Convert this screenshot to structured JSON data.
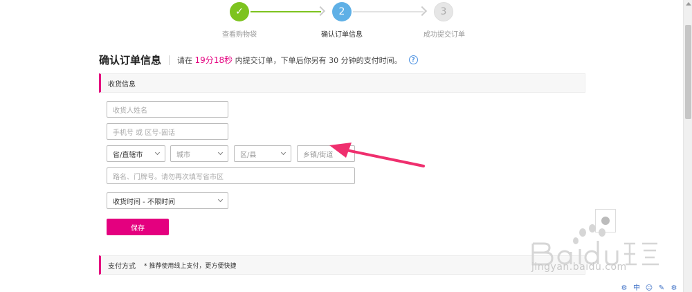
{
  "stepper": {
    "steps": [
      {
        "number": "✓",
        "label": "查看购物袋"
      },
      {
        "number": "2",
        "label": "确认订单信息"
      },
      {
        "number": "3",
        "label": "成功提交订单"
      }
    ]
  },
  "heading": {
    "title": "确认订单信息",
    "note_prefix": "请在",
    "minutes": "19",
    "unit_min": "分",
    "seconds": "18",
    "unit_sec": "秒",
    "note_suffix": "内提交订单，下单后你另有 30 分钟的支付时间。",
    "help": "?"
  },
  "shipping": {
    "section_title": "收货信息",
    "name_placeholder": "收货人姓名",
    "phone_placeholder": "手机号 或 区号-固话",
    "province": "省/直辖市",
    "city": "城市",
    "district": "区/县",
    "town": "乡镇/街道",
    "address_placeholder": "路名、门牌号。请勿再次填写省市区",
    "delivery_time": "收货时间 - 不限时间",
    "save_label": "保存"
  },
  "payment": {
    "section_title": "支付方式",
    "note": "* 推荐使用线上支付，更方便快捷"
  },
  "watermark": {
    "text": "jingyan.baidu.com"
  },
  "colors": {
    "accent": "#e4007f",
    "done": "#7dc31f",
    "current": "#5fb0e6",
    "pending": "#e6e6e6"
  }
}
